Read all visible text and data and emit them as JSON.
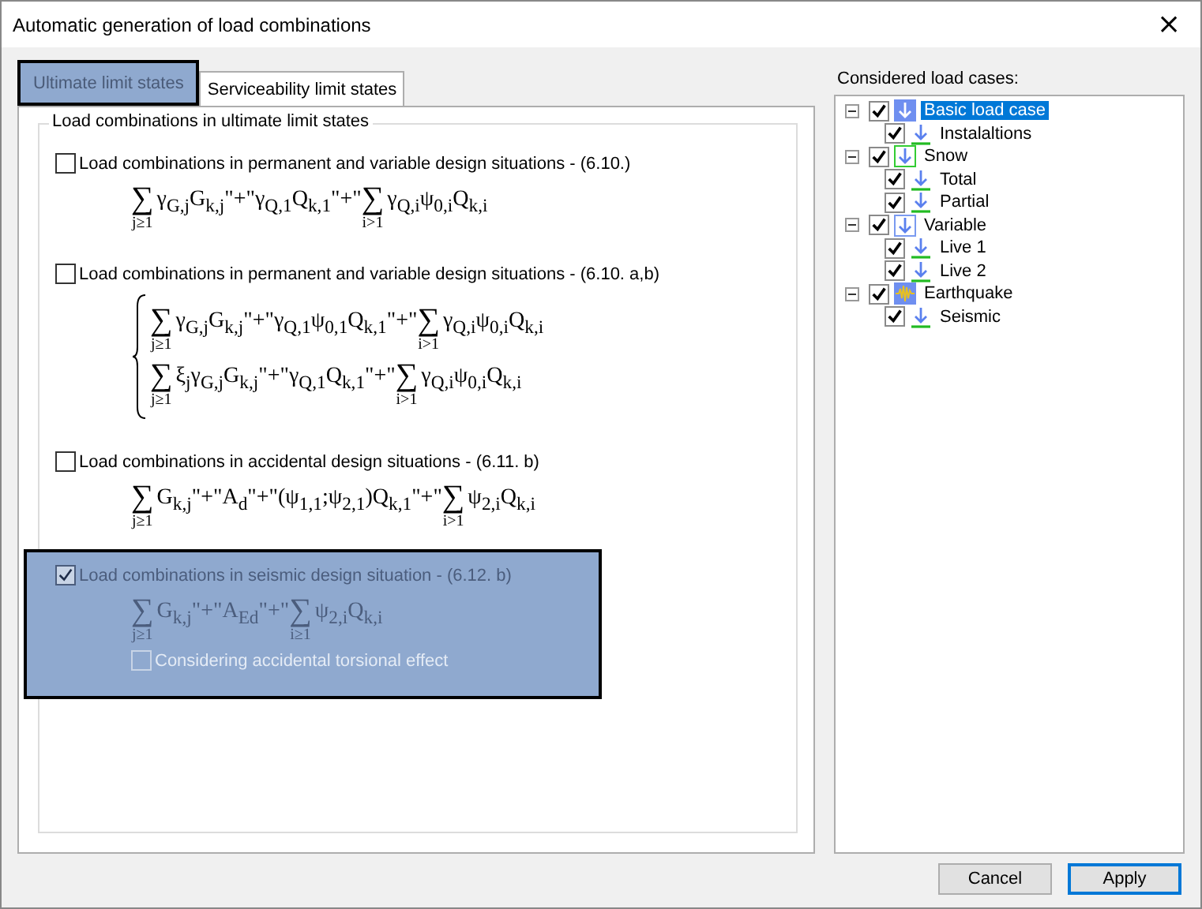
{
  "window": {
    "title": "Automatic generation of load combinations",
    "close": "×"
  },
  "tabs": [
    {
      "label": "Ultimate limit states",
      "selected": true
    },
    {
      "label": "Serviceability limit states",
      "selected": false
    }
  ],
  "group": {
    "title": "Load combinations in ultimate limit states",
    "sections": [
      {
        "label": "Load combinations in permanent and variable design situations - (6.10.)",
        "checked": false,
        "disabled": false,
        "selected": false,
        "braced": false,
        "lines": [
          [
            {
              "kind": "sum",
              "symbol": "∑",
              "below": "j≥1"
            },
            {
              "kind": "text",
              "text": "γ$_{G,j}$G$_{k,j}$\"+\"γ$_{Q,1}$Q$_{k,1}$\"+\""
            },
            {
              "kind": "sum",
              "symbol": "∑",
              "below": "i>1"
            },
            {
              "kind": "text",
              "text": "γ$_{Q,i}$ψ$_{0,i}$Q$_{k,i}$"
            }
          ]
        ]
      },
      {
        "label": "Load combinations in permanent and variable design situations - (6.10. a,b)",
        "checked": false,
        "disabled": false,
        "selected": false,
        "braced": true,
        "lines": [
          [
            {
              "kind": "sum",
              "symbol": "∑",
              "below": "j≥1"
            },
            {
              "kind": "text",
              "text": "γ$_{G,j}$G$_{k,j}$\"+\"γ$_{Q,1}$ψ$_{0,1}$Q$_{k,1}$\"+\""
            },
            {
              "kind": "sum",
              "symbol": "∑",
              "below": "i>1"
            },
            {
              "kind": "text",
              "text": "γ$_{Q,i}$ψ$_{0,i}$Q$_{k,i}$"
            }
          ],
          [
            {
              "kind": "sum",
              "symbol": "∑",
              "below": "j≥1"
            },
            {
              "kind": "text",
              "text": "ξ$_{j}$γ$_{G,j}$G$_{k,j}$\"+\"γ$_{Q,1}$Q$_{k,1}$\"+\""
            },
            {
              "kind": "sum",
              "symbol": "∑",
              "below": "i>1"
            },
            {
              "kind": "text",
              "text": "γ$_{Q,i}$ψ$_{0,i}$Q$_{k,i}$"
            }
          ]
        ]
      },
      {
        "label": "Load combinations in accidental design situations - (6.11. b)",
        "checked": false,
        "disabled": false,
        "selected": false,
        "braced": false,
        "lines": [
          [
            {
              "kind": "sum",
              "symbol": "∑",
              "below": "j≥1"
            },
            {
              "kind": "text",
              "text": "G$_{k,j}$\"+\"A$_{d}$\"+\"(ψ$_{1,1}$;ψ$_{2,1}$)Q$_{k,1}$\"+\""
            },
            {
              "kind": "sum",
              "symbol": "∑",
              "below": "i>1"
            },
            {
              "kind": "text",
              "text": "ψ$_{2,i}$Q$_{k,i}$"
            }
          ]
        ]
      },
      {
        "label": "Load combinations in seismic design situation - (6.12. b)",
        "checked": true,
        "disabled": true,
        "selected": true,
        "braced": false,
        "lines": [
          [
            {
              "kind": "sum",
              "symbol": "∑",
              "below": "j≥1"
            },
            {
              "kind": "text",
              "text": "G$_{k,j}$\"+\"A$_{Ed}$\"+\""
            },
            {
              "kind": "sum",
              "symbol": "∑",
              "below": "i≥1"
            },
            {
              "kind": "text",
              "text": "ψ$_{2,i}$Q$_{k,i}$"
            }
          ]
        ],
        "sub_option": {
          "label": "Considering accidental torsional effect",
          "checked": false,
          "disabled": true
        }
      }
    ]
  },
  "load_cases": {
    "title": "Considered load cases:",
    "tree": [
      {
        "label": "Basic load case",
        "kind": "group-filled",
        "checked": true,
        "selected": true,
        "expanded": true,
        "children": [
          {
            "label": "Instalaltions",
            "kind": "load",
            "checked": true,
            "selected": false
          }
        ]
      },
      {
        "label": "Snow",
        "kind": "group-outline",
        "checked": true,
        "selected": false,
        "expanded": true,
        "children": [
          {
            "label": "Total",
            "kind": "load",
            "checked": true,
            "selected": false
          },
          {
            "label": "Partial",
            "kind": "load",
            "checked": true,
            "selected": false
          }
        ]
      },
      {
        "label": "Variable",
        "kind": "group-outline",
        "checked": true,
        "selected": false,
        "expanded": true,
        "children": [
          {
            "label": "Live 1",
            "kind": "load",
            "checked": true,
            "selected": false
          },
          {
            "label": "Live 2",
            "kind": "load",
            "checked": true,
            "selected": false
          }
        ]
      },
      {
        "label": "Earthquake",
        "kind": "seismic",
        "checked": true,
        "selected": false,
        "expanded": true,
        "children": [
          {
            "label": "Seismic",
            "kind": "load",
            "checked": true,
            "selected": false
          }
        ]
      }
    ]
  },
  "buttons": [
    {
      "label": "Cancel",
      "default": false
    },
    {
      "label": "Apply",
      "default": true
    }
  ]
}
